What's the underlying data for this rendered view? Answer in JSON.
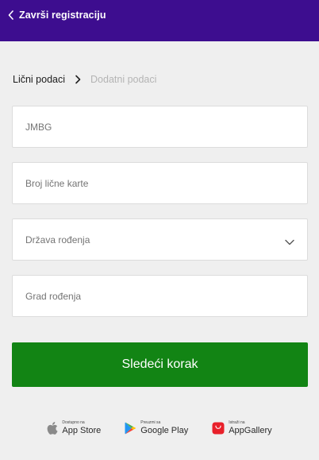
{
  "header": {
    "title": "Završi registraciju",
    "background": "#3d0d8f"
  },
  "steps": {
    "current": "Lični podaci",
    "next": "Dodatni podaci"
  },
  "fields": {
    "jmbg": "JMBG",
    "id_card": "Broj lične karte",
    "country_of_birth": "Država rođenja",
    "city_of_birth": "Grad rođenja"
  },
  "submit": {
    "label": "Sledeći korak",
    "color": "#128414"
  },
  "stores": {
    "apple": {
      "small": "Dostupno na",
      "name": "App Store",
      "icon": "apple-icon"
    },
    "google": {
      "small": "Preuzmi sa",
      "name": "Google Play",
      "icon": "google-play-icon"
    },
    "huawei": {
      "small": "Istraži na",
      "name": "AppGallery",
      "icon": "huawei-appgallery-icon"
    }
  }
}
